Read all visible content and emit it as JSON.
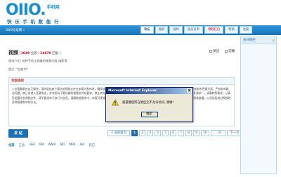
{
  "brand": {
    "logo": "OIIO.",
    "logo_sub": "手机网",
    "slogan": "快 乐 手 机 数 能 行"
  },
  "topbar": {
    "breadcrumb": "OIIO论坛网 »  ",
    "tabs": [
      {
        "label": "论坛"
      },
      {
        "label": "搜索"
      },
      {
        "label": "插件"
      },
      {
        "label": "会员名单"
      },
      {
        "label": "领取红包"
      },
      {
        "label": "帮助"
      },
      {
        "label": "注册"
      }
    ]
  },
  "thread": {
    "title": "视频",
    "meta_prefix": "[",
    "topic_count": "1049",
    "meta_topics": " 主题 / ",
    "post_count": "24870",
    "meta_posts": " 回复 ]",
    "action_collect": "关注",
    "action_rss": "订阅",
    "intro": "版块介绍: 各种手机上观看的视频内容,电影等",
    "note": "版主: *空缺中*"
  },
  "rules": {
    "head": "本版规则",
    "body": "1.在观看前应自己操作，请勿轻信各个版式的视频文件在本版内发布时，确保该文件内容健康，正确的文件上传以及文件格式，所有视频文件需有 手机上严禁发布色情方面，严禁发布政治问题，禁止对他人恶意攻击，并非所有下载功能的视频文件有要求，禁止转存的视频文件以超过视频上传同时，以上多视频的重载应是视频连续中，（相关请求），请删除等要求，认真仔细遵守此视频文件，请不要发布不良行为信息，请删除此版块中，本版可视频的内容请勿在其他平台转载使用，让我们的协议的和谐管理，相关规定和说明请查看，以及包括其对视频的多种管理和中的方法。"
  },
  "post_button": "发 帖",
  "pager": {
    "prev": "< 返回首页",
    "pages": [
      "1",
      "2",
      "3",
      "4",
      "5",
      "6",
      "7",
      "8",
      "9",
      "10"
    ],
    "ellipsis": "... 31",
    "next": "下一页 >"
  },
  "filters": [
    "全部",
    "汇总",
    "3GP",
    "RM",
    "WMV",
    "MO",
    "MP4",
    "AVI",
    "其它"
  ],
  "sidebar": {
    "head": "关闭侧栏",
    "close": "x"
  },
  "dialog": {
    "title": "Microsoft Internet Explorer",
    "close": "x",
    "message": "很遗憾您所在地区无不允许访问, 谢谢!",
    "ok": "确定"
  },
  "colors": {
    "accent": "#1a6fb5",
    "nav_gradient_top": "#2f94d8",
    "highlight_red": "#d0021b",
    "dialog_title": "#0a246a"
  }
}
